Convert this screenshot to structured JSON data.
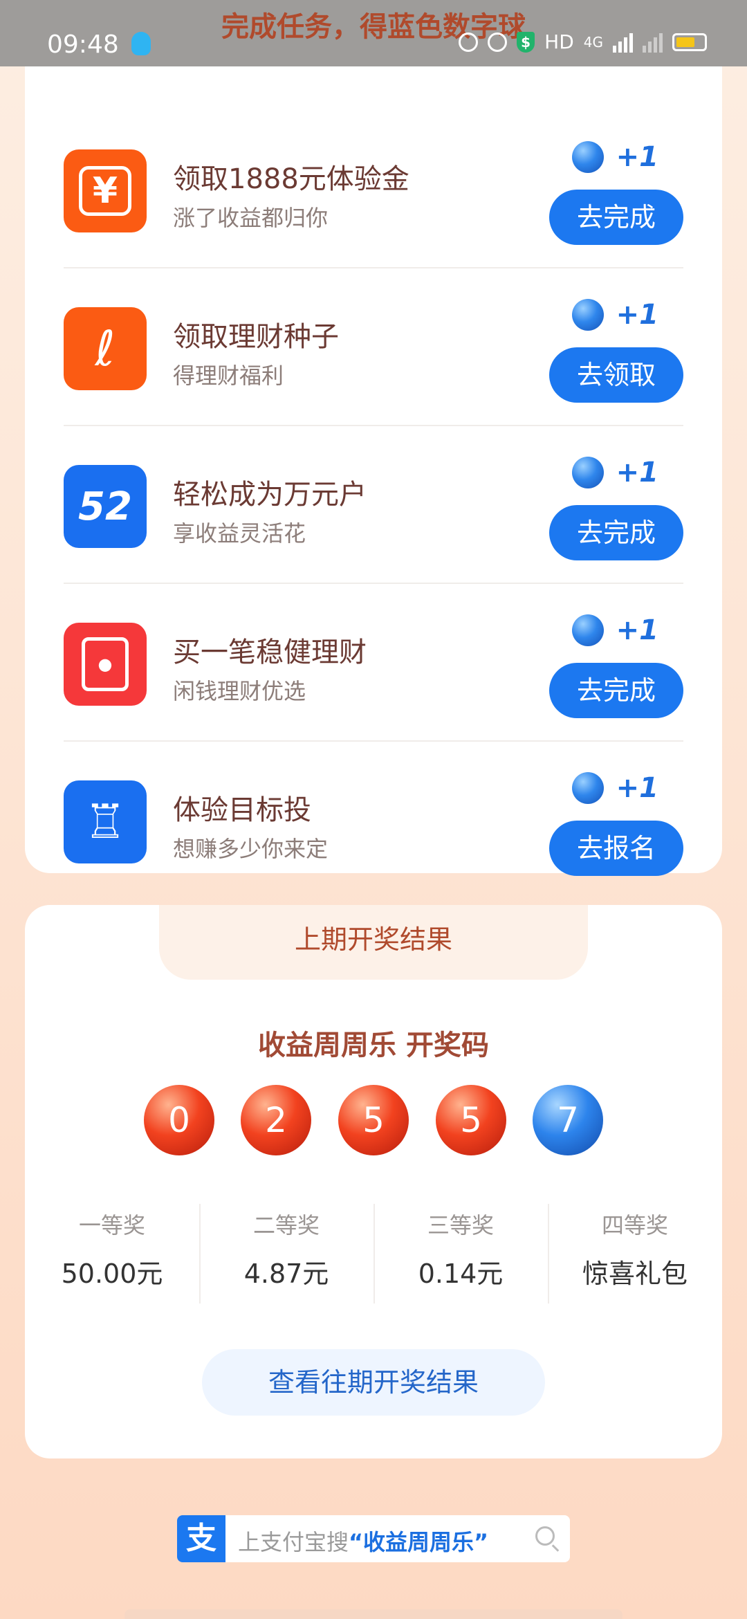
{
  "status": {
    "time": "09:48",
    "banner_title": "完成任务，得蓝色数字球",
    "network": "HD",
    "signal": "4G"
  },
  "tasks": [
    {
      "title": "领取1888元体验金",
      "subtitle": "涨了收益都归你",
      "reward": "+1",
      "button": "去完成",
      "icon": "tv-yen-icon",
      "icon_glyph": "¥",
      "color": "#fb5b13"
    },
    {
      "title": "领取理财种子",
      "subtitle": "得理财福利",
      "reward": "+1",
      "button": "去领取",
      "icon": "seed-bag-icon",
      "icon_glyph": "ℓ",
      "color": "#fb5b13"
    },
    {
      "title": "轻松成为万元户",
      "subtitle": "享收益灵活花",
      "reward": "+1",
      "button": "去完成",
      "icon": "52-badge-icon",
      "icon_glyph": "52",
      "color": "#1a6ff0"
    },
    {
      "title": "买一笔稳健理财",
      "subtitle": "闲钱理财优选",
      "reward": "+1",
      "button": "去完成",
      "icon": "red-envelope-icon",
      "icon_glyph": "●",
      "color": "#f5383a"
    },
    {
      "title": "体验目标投",
      "subtitle": "想赚多少你来定",
      "reward": "+1",
      "button": "去报名",
      "icon": "target-tower-icon",
      "icon_glyph": "♖",
      "color": "#1a6ff0"
    }
  ],
  "result": {
    "tab_title": "上期开奖结果",
    "subtitle": "收益周周乐 开奖码",
    "numbers": [
      "0",
      "2",
      "5",
      "5",
      "7"
    ],
    "prizes": [
      {
        "name": "一等奖",
        "value": "50.00元"
      },
      {
        "name": "二等奖",
        "value": "4.87元"
      },
      {
        "name": "三等奖",
        "value": "0.14元"
      },
      {
        "name": "四等奖",
        "value": "惊喜礼包"
      }
    ],
    "history_button": "查看往期开奖结果"
  },
  "search": {
    "logo": "支",
    "prefix": "上支付宝搜",
    "keyword": "“收益周周乐”"
  }
}
